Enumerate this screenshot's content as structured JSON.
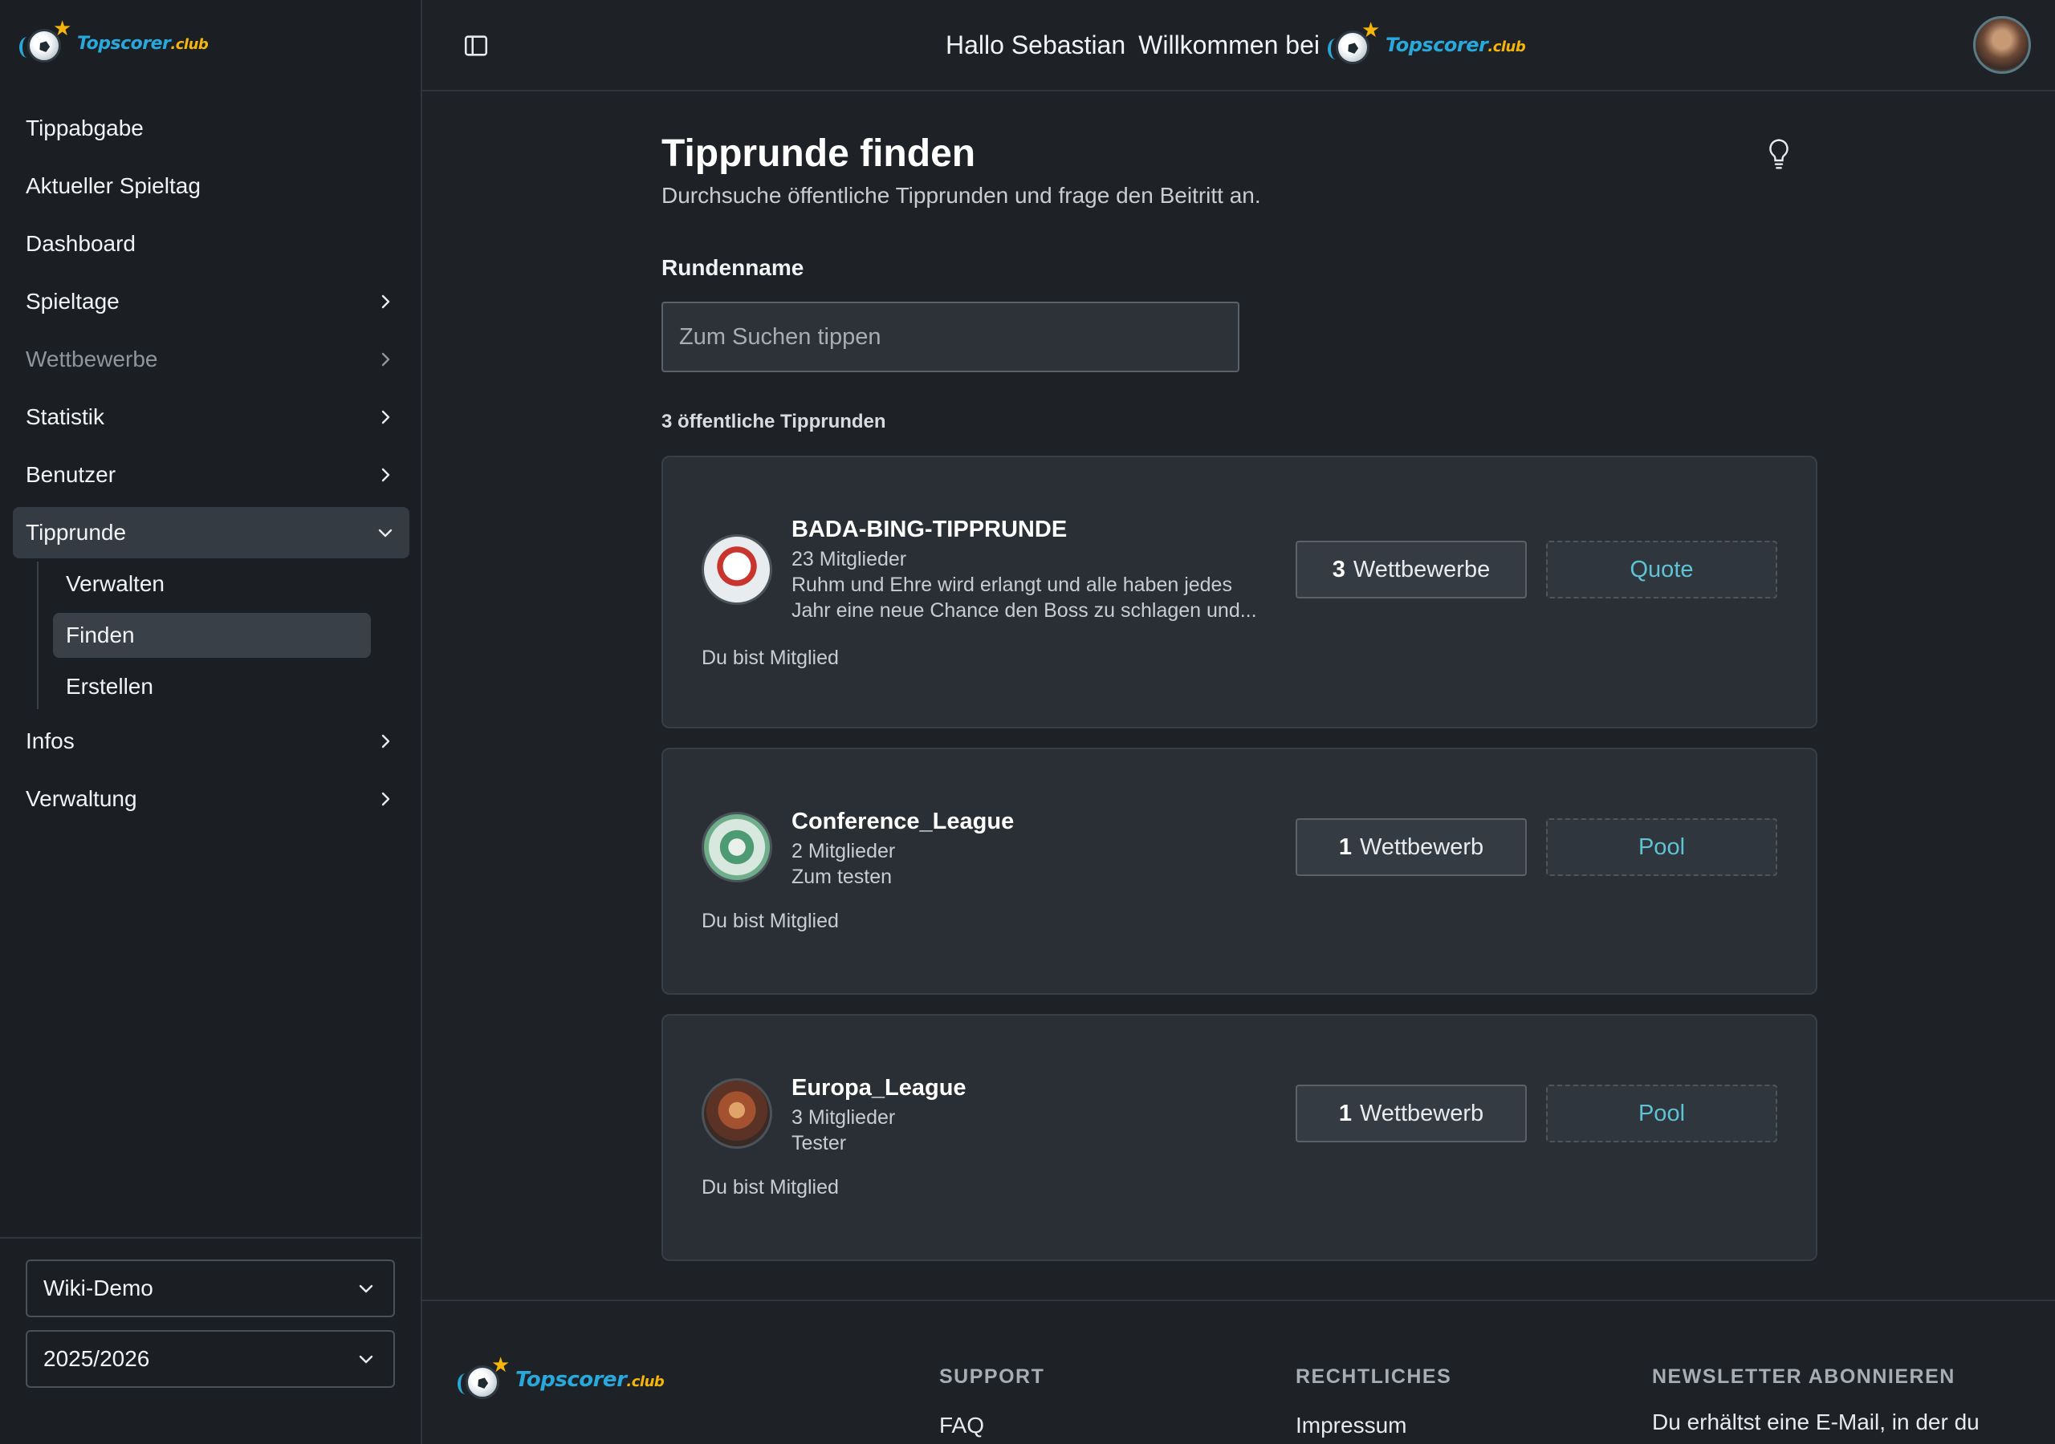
{
  "brand": {
    "logo_name": "Topscorer",
    "logo_suffix": ".club"
  },
  "sidebar": {
    "items": [
      {
        "label": "Tippabgabe"
      },
      {
        "label": "Aktueller Spieltag"
      },
      {
        "label": "Dashboard"
      },
      {
        "label": "Spieltage"
      },
      {
        "label": "Wettbewerbe"
      },
      {
        "label": "Statistik"
      },
      {
        "label": "Benutzer"
      },
      {
        "label": "Tipprunde"
      },
      {
        "label": "Infos"
      },
      {
        "label": "Verwaltung"
      }
    ],
    "sub_items": [
      {
        "label": "Verwalten"
      },
      {
        "label": "Finden"
      },
      {
        "label": "Erstellen"
      }
    ],
    "group_select": "Wiki-Demo",
    "season_select": "2025/2026"
  },
  "header": {
    "greeting": "Hallo Sebastian",
    "welcome": "Willkommen bei"
  },
  "page": {
    "title": "Tipprunde finden",
    "subtitle": "Durchsuche öffentliche Tipprunden und frage den Beitritt an.",
    "field_label": "Rundenname",
    "search_placeholder": "Zum Suchen tippen",
    "count_label": "3 öffentliche Tipprunden"
  },
  "rounds": [
    {
      "name": "BADA-BING-TIPPRUNDE",
      "members": "23 Mitglieder",
      "description": "Ruhm und Ehre wird erlangt und alle haben jedes Jahr eine neue Chance den Boss zu schlagen und...",
      "membership": "Du bist Mitglied",
      "competitions_count": "3",
      "competitions_label": "Wettbewerbe",
      "type": "Quote"
    },
    {
      "name": "Conference_League",
      "members": "2 Mitglieder",
      "description": "Zum testen",
      "membership": "Du bist Mitglied",
      "competitions_count": "1",
      "competitions_label": "Wettbewerb",
      "type": "Pool"
    },
    {
      "name": "Europa_League",
      "members": "3 Mitglieder",
      "description": "Tester",
      "membership": "Du bist Mitglied",
      "competitions_count": "1",
      "competitions_label": "Wettbewerb",
      "type": "Pool"
    }
  ],
  "footer": {
    "support_heading": "SUPPORT",
    "support_link": "FAQ",
    "legal_heading": "RECHTLICHES",
    "legal_link": "Impressum",
    "newsletter_heading": "NEWSLETTER ABONNIEREN",
    "newsletter_text": "Du erhältst eine E-Mail, in der du"
  }
}
